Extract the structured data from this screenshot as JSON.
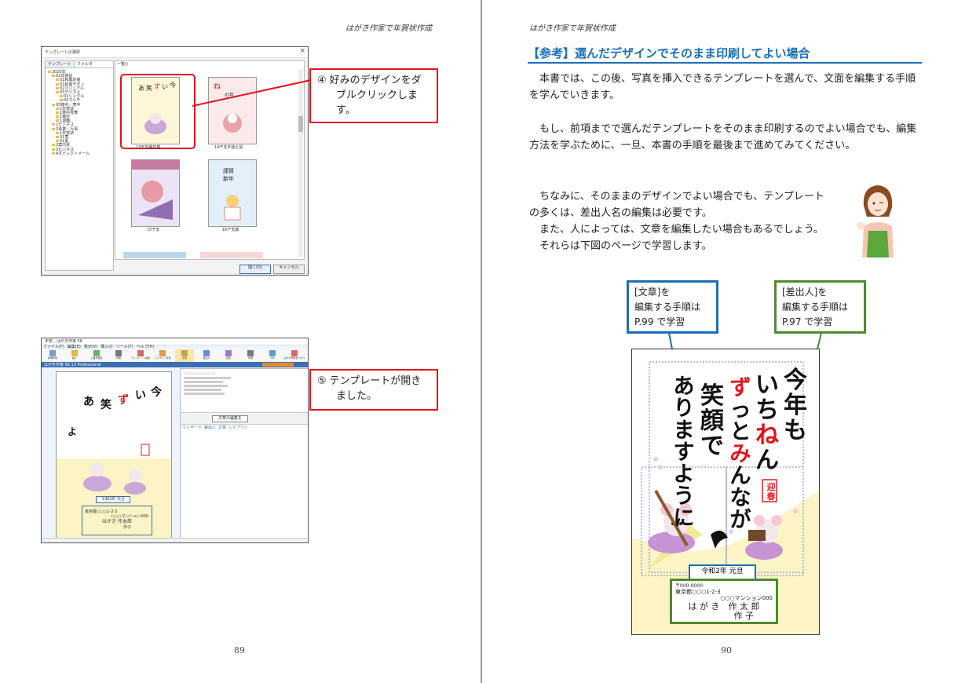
{
  "left_page": {
    "header": "はがき作家で年賀状作成",
    "page_number": "89",
    "dialog": {
      "title": "テンプレートの選択",
      "tabs": [
        "テンプレート",
        "フォルダ"
      ],
      "list_label": "一覧()",
      "tree": [
        "2020年",
        "01年賀状",
        "01和風定番",
        "01和風モダン",
        "02カジュアル",
        "03デジカメ",
        "01シングル",
        "02マルチ",
        "05喪中・寒中",
        "1年賀状",
        "1寒中見舞",
        "1喪中",
        "1退職",
        "2ビジネス",
        "3事業・行事",
        "1年賀状",
        "01寒",
        "01夏",
        "2案内状",
        "3ビジネス",
        "4ダイレクトメール"
      ],
      "thumbnails": [
        "13干支版年賀",
        "14干支手抜土鼠",
        "15干支",
        "16干支版"
      ],
      "buttons": {
        "open": "開く(O)",
        "cancel": "キャンセル"
      }
    },
    "callout4": {
      "num": "④",
      "text": "好みのデザインをダブルクリックします。"
    },
    "app": {
      "title": "年賀 - はがき作家 56",
      "menu": [
        "ファイル(F)",
        "編集(E)",
        "表示(V)",
        "挿入(I)",
        "ツール(T)",
        "ヘルプ(H)"
      ],
      "toolbar": [
        "新規作成",
        "開く",
        "上書き保存",
        "印刷",
        "テンプレート選択",
        "イラスト・写真",
        "文章",
        "差出人",
        "宛名",
        "印刷",
        "DM",
        "はがき作家をつかう"
      ],
      "app_name": "はがき作家 56 13 Professional",
      "panel_button": "文章の編集を",
      "tabs": [
        "ウィザード",
        "差出人",
        "文章",
        "レイアウト"
      ],
      "card_date": "令和2年 元旦",
      "card_address": "東京都○○○1-2-3",
      "card_building": "○○○マンション000",
      "card_name": "はがき 作太郎",
      "card_name2": "作子"
    },
    "callout5": {
      "num": "⑤",
      "text": "テンプレートが開きました。"
    }
  },
  "right_page": {
    "header": "はがき作家で年賀状作成",
    "heading": "【参考】選んだデザインでそのまま印刷してよい場合",
    "paragraphs": [
      "本書では、この後、写真を挿入できるテンプレートを選んで、文面を編集する手順を学んでいきます。",
      "もし、前項までで選んだテンプレートをそのまま印刷するのでよい場合でも、編集方法を学ぶために、一旦、本書の手順を最後まで進めてみてください。"
    ],
    "note_lines": [
      "ちなみに、そのままのデザインでよい場合でも、テンプレート",
      "の多くは、差出人名の編集は必要です。",
      "また、人によっては、文章を編集したい場合もあるでしょう。",
      "それらは下図のページで学習します。"
    ],
    "label_text": [
      "[文章]を",
      "編集する手順は",
      "P.99 で学習"
    ],
    "label_sender": [
      "[差出人]を",
      "編集する手順は",
      "P.97 で学習"
    ],
    "card": {
      "columns": [
        "今年も",
        "いちねん",
        "ずっとみんなが",
        "笑顔で",
        "ありますように"
      ],
      "stamp": "迎春",
      "date": "令和2年 元旦",
      "postal": "〒000-0000",
      "address": "東京都○○○1-2-3",
      "building": "○○○マンション000",
      "name": "は が き　作 太 郎",
      "name2": "作 子"
    },
    "page_number": "90"
  },
  "colors": {
    "red": "#e0141c",
    "blue": "#1a6fb5",
    "green": "#4f8a2e",
    "card_yellow": "#fbf4c4"
  }
}
